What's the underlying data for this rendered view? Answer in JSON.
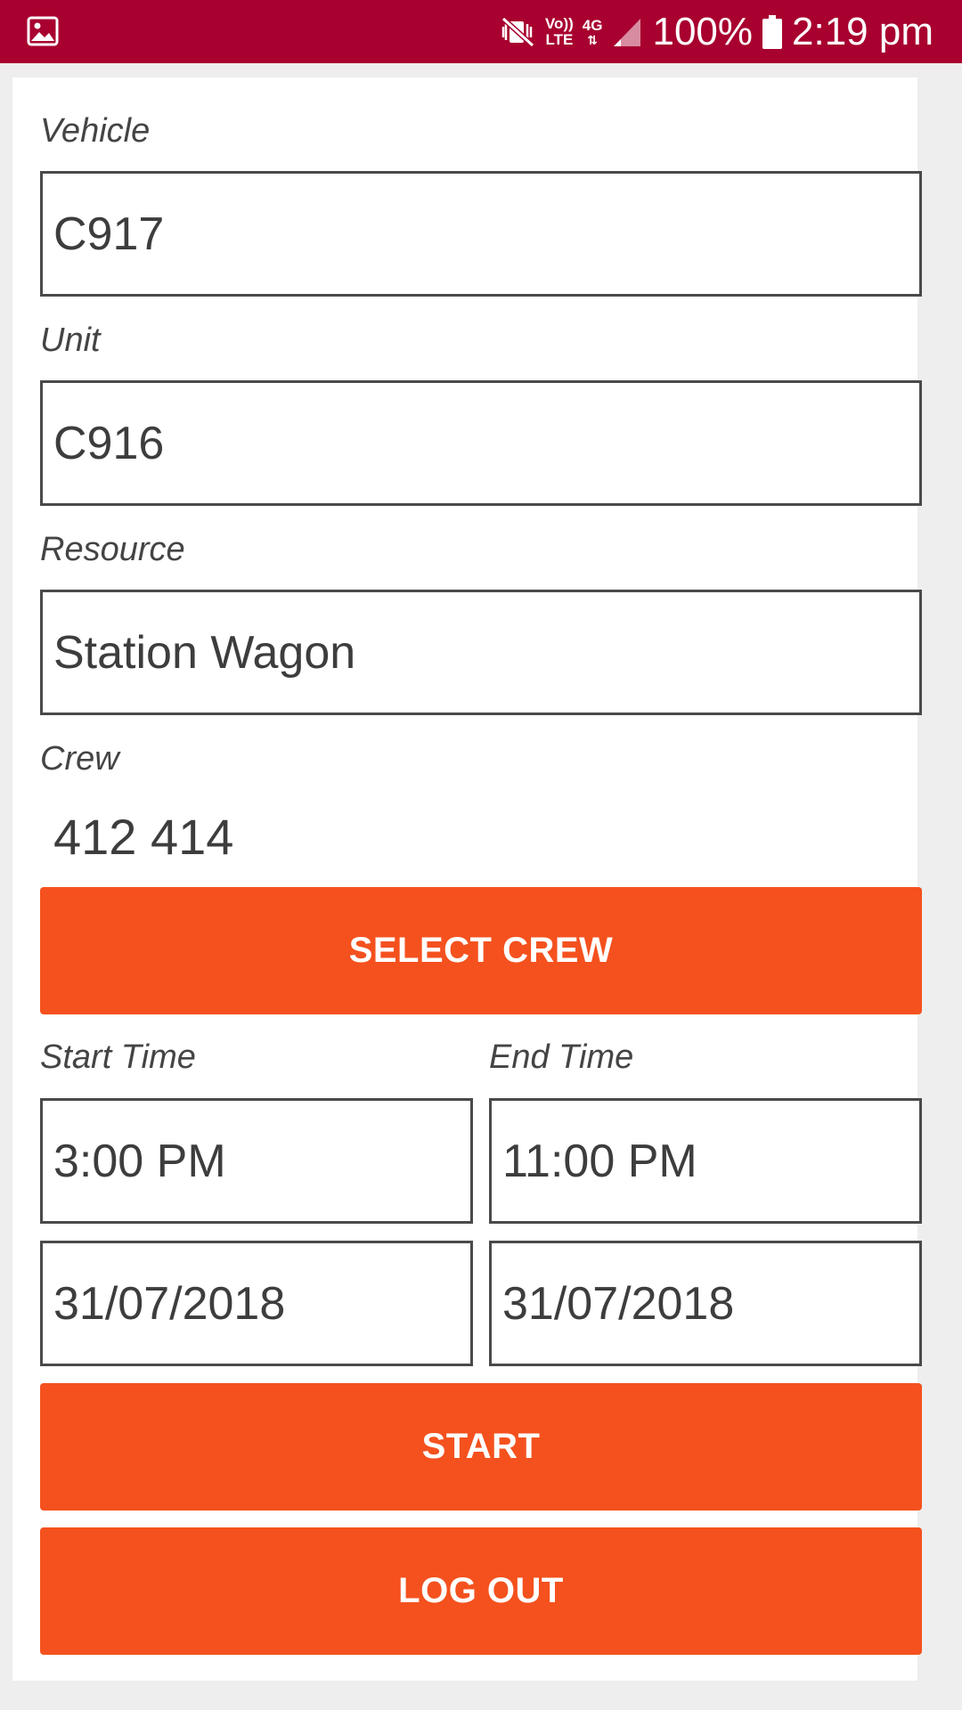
{
  "status_bar": {
    "left_icon": "image-icon",
    "icons": [
      "mute-vibrate-icon",
      "volte-icon",
      "4g-icon",
      "signal-icon"
    ],
    "volte_top": "Vo))",
    "volte_bottom": "LTE",
    "net_type": "4G",
    "battery_percent": "100%",
    "battery_icon": "battery-icon",
    "time": "2:19 pm",
    "background_color": "#a8002f"
  },
  "form": {
    "vehicle": {
      "label": "Vehicle",
      "value": "C917"
    },
    "unit": {
      "label": "Unit",
      "value": "C916"
    },
    "resource": {
      "label": "Resource",
      "value": "Station Wagon"
    },
    "crew": {
      "label": "Crew",
      "value": "412 414"
    },
    "select_crew_label": "SELECT CREW",
    "start_time": {
      "label": "Start Time",
      "time": "3:00 PM",
      "date": "31/07/2018"
    },
    "end_time": {
      "label": "End Time",
      "time": "11:00 PM",
      "date": "31/07/2018"
    },
    "start_label": "START",
    "logout_label": "LOG OUT"
  },
  "colors": {
    "accent": "#f4511e",
    "status_bar": "#a8002f",
    "field_border": "#4a4a4a",
    "background": "#eeeeee"
  }
}
